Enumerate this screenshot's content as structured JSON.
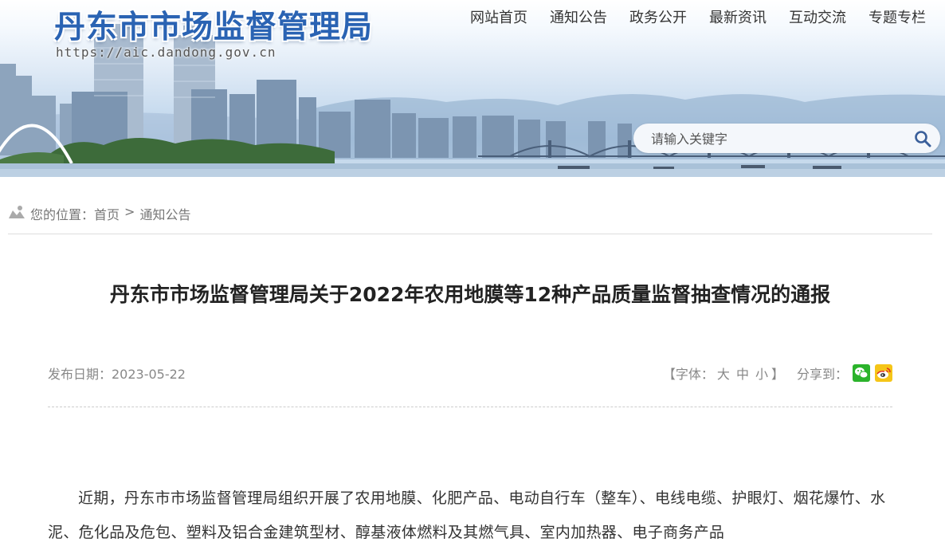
{
  "header": {
    "site_title": "丹东市市场监督管理局",
    "site_url": "https://aic.dandong.gov.cn",
    "nav": [
      {
        "label": "网站首页"
      },
      {
        "label": "通知公告"
      },
      {
        "label": "政务公开"
      },
      {
        "label": "最新资讯"
      },
      {
        "label": "互动交流"
      },
      {
        "label": "专题专栏"
      }
    ],
    "search_placeholder": "请输入关键字",
    "search_icon": "search-icon"
  },
  "breadcrumb": {
    "prefix": "您的位置：",
    "home": "首页",
    "separator": ">",
    "current": "通知公告"
  },
  "article": {
    "title": "丹东市市场监督管理局关于2022年农用地膜等12种产品质量监督抽查情况的通报",
    "date_label": "发布日期：2023-05-22",
    "font_size_open": "【字体：",
    "font_large": "大",
    "font_medium": "中",
    "font_small": "小",
    "font_size_close": "】",
    "share_label": "分享到：",
    "share_icons": [
      "wechat-icon",
      "weibo-icon"
    ],
    "body": "近期，丹东市市场监督管理局组织开展了农用地膜、化肥产品、电动自行车（整车）、电线电缆、护眼灯、烟花爆竹、水泥、危化品及危包、塑料及铝合金建筑型材、醇基液体燃料及其燃气具、室内加热器、电子商务产品"
  },
  "colors": {
    "title_blue": "#2a63b3",
    "wechat_green": "#2bb32b",
    "weibo_yellow": "#f5c518"
  }
}
